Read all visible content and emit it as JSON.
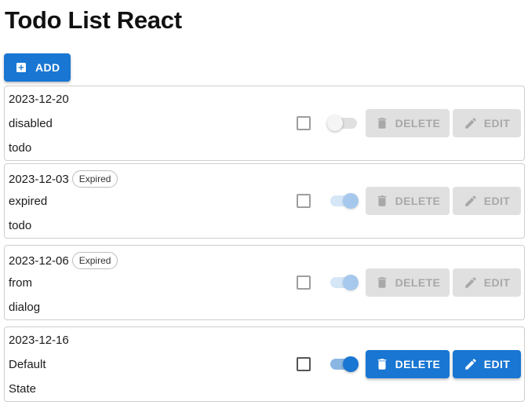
{
  "header": {
    "title": "Todo List React"
  },
  "toolbar": {
    "add_label": "ADD",
    "add_icon": "plus-square-icon"
  },
  "colors": {
    "primary": "#1976d2",
    "disabled_bg": "#e0e0e0",
    "disabled_text": "#a8a8a8",
    "card_border": "#cfcfcf"
  },
  "todos": [
    {
      "date": "2023-12-20",
      "badge": "",
      "title": "disabled",
      "body": "todo",
      "checked": false,
      "toggle_on": false,
      "actions_enabled": false,
      "delete_label": "DELETE",
      "edit_label": "EDIT"
    },
    {
      "date": "2023-12-03",
      "badge": "Expired",
      "title": "expired",
      "body": "todo",
      "checked": false,
      "toggle_on": true,
      "actions_enabled": false,
      "delete_label": "DELETE",
      "edit_label": "EDIT"
    },
    {
      "date": "2023-12-06",
      "badge": "Expired",
      "title": "from",
      "body": "dialog",
      "checked": false,
      "toggle_on": true,
      "actions_enabled": false,
      "delete_label": "DELETE",
      "edit_label": "EDIT"
    },
    {
      "date": "2023-12-16",
      "badge": "",
      "title": "Default",
      "body": "State",
      "checked": false,
      "toggle_on": true,
      "actions_enabled": true,
      "delete_label": "DELETE",
      "edit_label": "EDIT"
    }
  ]
}
